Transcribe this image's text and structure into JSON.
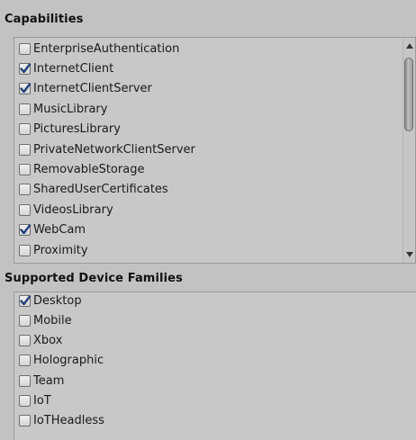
{
  "capabilities": {
    "title": "Capabilities",
    "items": [
      {
        "label": "EnterpriseAuthentication",
        "checked": false
      },
      {
        "label": "InternetClient",
        "checked": true
      },
      {
        "label": "InternetClientServer",
        "checked": true
      },
      {
        "label": "MusicLibrary",
        "checked": false
      },
      {
        "label": "PicturesLibrary",
        "checked": false
      },
      {
        "label": "PrivateNetworkClientServer",
        "checked": false
      },
      {
        "label": "RemovableStorage",
        "checked": false
      },
      {
        "label": "SharedUserCertificates",
        "checked": false
      },
      {
        "label": "VideosLibrary",
        "checked": false
      },
      {
        "label": "WebCam",
        "checked": true
      },
      {
        "label": "Proximity",
        "checked": false
      }
    ],
    "scroll_position": 0.0
  },
  "device_families": {
    "title": "Supported Device Families",
    "items": [
      {
        "label": "Desktop",
        "checked": true
      },
      {
        "label": "Mobile",
        "checked": false
      },
      {
        "label": "Xbox",
        "checked": false
      },
      {
        "label": "Holographic",
        "checked": false
      },
      {
        "label": "Team",
        "checked": false
      },
      {
        "label": "IoT",
        "checked": false
      },
      {
        "label": "IoTHeadless",
        "checked": false
      }
    ]
  },
  "icons": {
    "checkmark": "checkmark-icon",
    "scroll_up": "arrow-up-icon",
    "scroll_down": "arrow-down-icon"
  },
  "colors": {
    "background": "#c2c2c2",
    "checkmark": "#1f3f7a"
  }
}
